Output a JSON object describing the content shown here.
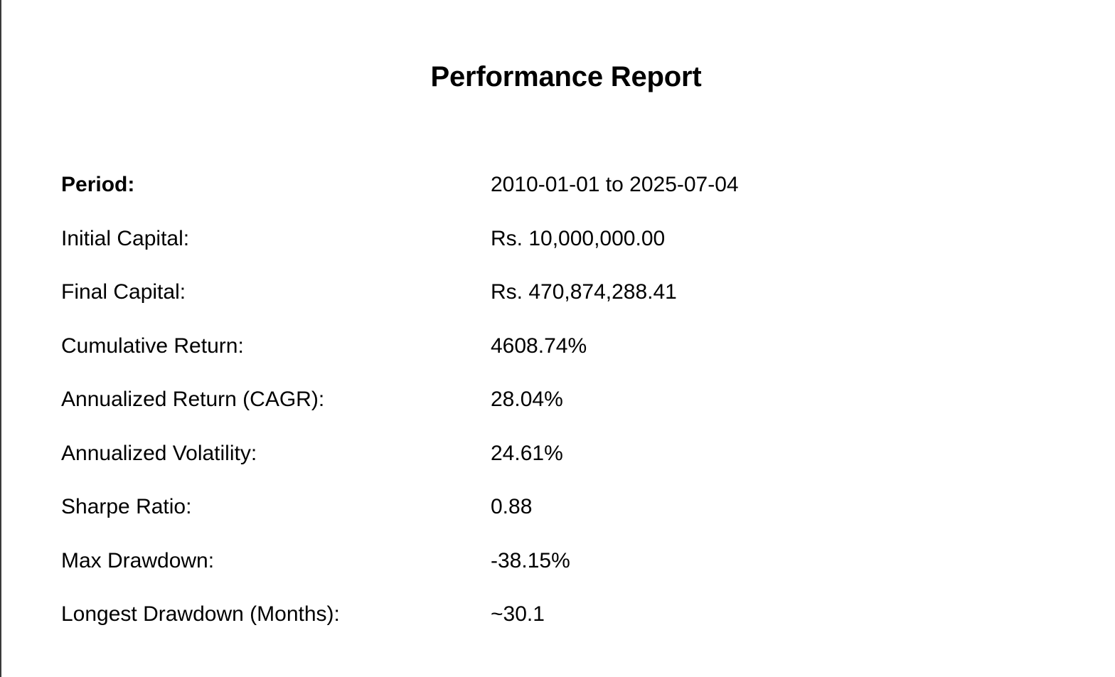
{
  "report": {
    "title": "Performance Report",
    "rows": [
      {
        "label": "Period:",
        "value": "2010-01-01 to 2025-07-04"
      },
      {
        "label": "Initial Capital:",
        "value": "Rs. 10,000,000.00"
      },
      {
        "label": "Final Capital:",
        "value": "Rs. 470,874,288.41"
      },
      {
        "label": "Cumulative Return:",
        "value": "4608.74%"
      },
      {
        "label": "Annualized Return (CAGR):",
        "value": "28.04%"
      },
      {
        "label": "Annualized Volatility:",
        "value": "24.61%"
      },
      {
        "label": "Sharpe Ratio:",
        "value": "0.88"
      },
      {
        "label": "Max Drawdown:",
        "value": "-38.15%"
      },
      {
        "label": "Longest Drawdown (Months):",
        "value": "~30.1"
      }
    ]
  }
}
